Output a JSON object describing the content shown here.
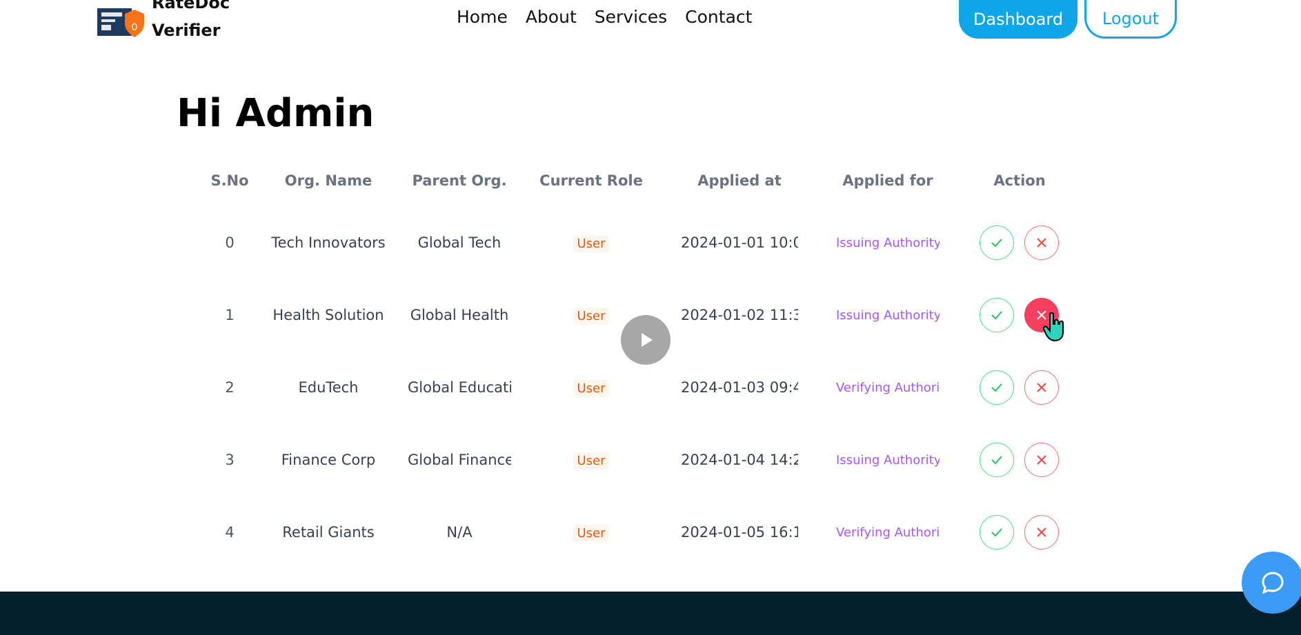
{
  "header": {
    "logo_line1": "RateDoc",
    "logo_line2": "Verifier",
    "nav": [
      "Home",
      "About",
      "Services",
      "Contact"
    ],
    "dashboard_label": "Dashboard",
    "logout_label": "Logout"
  },
  "greeting": "Hi Admin",
  "table": {
    "headers": [
      "S.No",
      "Org. Name",
      "Parent Org.",
      "Current Role",
      "Applied at",
      "Applied for",
      "Action"
    ],
    "rows": [
      {
        "sno": "0",
        "org": "Tech Innovators",
        "parent": "Global Tech",
        "role": "User",
        "applied_at": "2024-01-01 10:0",
        "applied_for": "Issuing Authority"
      },
      {
        "sno": "1",
        "org": "Health Solution",
        "parent": "Global Health",
        "role": "User",
        "applied_at": "2024-01-02 11:3",
        "applied_for": "Issuing Authority"
      },
      {
        "sno": "2",
        "org": "EduTech",
        "parent": "Global Educatio",
        "role": "User",
        "applied_at": "2024-01-03 09:4",
        "applied_for": "Verifying Authorit"
      },
      {
        "sno": "3",
        "org": "Finance Corp",
        "parent": "Global Finance",
        "role": "User",
        "applied_at": "2024-01-04 14:2",
        "applied_for": "Issuing Authority"
      },
      {
        "sno": "4",
        "org": "Retail Giants",
        "parent": "N/A",
        "role": "User",
        "applied_at": "2024-01-05 16:1",
        "applied_for": "Verifying Authorit"
      }
    ]
  },
  "colors": {
    "accent": "#0ea5e9",
    "approve": "#4ade80",
    "reject": "#f87171",
    "role_badge": "#ea580c",
    "applied_for": "#a855f7",
    "footer": "#04202f"
  },
  "icons": {
    "approve": "check-icon",
    "reject": "close-icon",
    "play": "play-icon",
    "chat": "chat-icon"
  }
}
